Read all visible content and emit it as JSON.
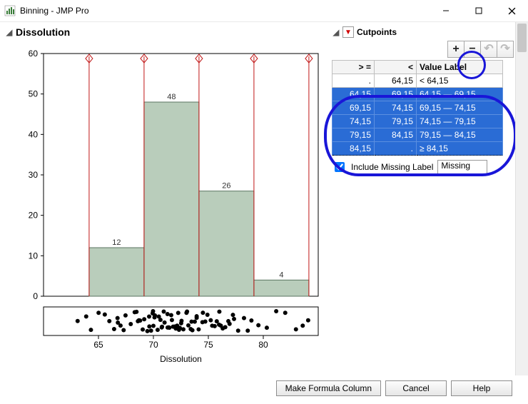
{
  "window": {
    "title": "Binning - JMP Pro"
  },
  "left_panel": {
    "header": "Dissolution"
  },
  "chart_data": {
    "type": "bar",
    "categories": [
      64.15,
      69.15,
      74.15,
      79.15,
      84.15
    ],
    "bar_centers": [
      66.65,
      71.65,
      76.65,
      81.65
    ],
    "values": [
      12,
      48,
      26,
      4
    ],
    "data_labels": [
      "12",
      "48",
      "26",
      "4"
    ],
    "xlabel": "Dissolution",
    "ylabel": "",
    "xticks": [
      65,
      70,
      75,
      80
    ],
    "yticks": [
      0,
      10,
      20,
      30,
      40,
      50,
      60
    ],
    "xlim": [
      60,
      85
    ],
    "ylim": [
      0,
      60
    ],
    "cutpoints": [
      64.15,
      69.15,
      74.15,
      79.15,
      84.15
    ],
    "rug_points": [
      63.2,
      63.8,
      64.4,
      65.0,
      65.6,
      66.0,
      66.4,
      66.8,
      66.8,
      67.0,
      67.2,
      67.4,
      68.0,
      68.2,
      68.4,
      68.6,
      68.6,
      68.8,
      69.0,
      69.2,
      69.4,
      69.6,
      69.6,
      69.8,
      70.0,
      70.0,
      70.0,
      70.2,
      70.2,
      70.4,
      70.4,
      70.6,
      70.8,
      70.8,
      71.0,
      71.0,
      71.2,
      71.2,
      71.4,
      71.4,
      71.6,
      71.6,
      71.8,
      72.0,
      72.0,
      72.2,
      72.2,
      72.4,
      72.4,
      72.6,
      72.6,
      72.8,
      73.0,
      73.0,
      73.2,
      73.4,
      73.4,
      73.6,
      73.8,
      74.0,
      74.0,
      74.2,
      74.4,
      74.6,
      74.8,
      75.0,
      75.2,
      75.4,
      75.6,
      75.8,
      76.0,
      76.0,
      76.2,
      76.4,
      76.6,
      76.8,
      77.0,
      77.2,
      77.4,
      77.8,
      78.2,
      78.6,
      79.0,
      79.6,
      80.4,
      81.2,
      82.0,
      83.0,
      83.6,
      84.0
    ]
  },
  "cutpoints_panel": {
    "header": "Cutpoints",
    "toolbar": {
      "add": "+",
      "remove": "−",
      "undo": "↶",
      "redo": "↷"
    },
    "columns": {
      "ge": "> =",
      "lt": "<",
      "label": "Value Label"
    },
    "rows": [
      {
        "ge": ".",
        "lt": "64,15",
        "label": "< 64,15",
        "selected": false
      },
      {
        "ge": "64,15",
        "lt": "69,15",
        "label": "64,15 — 69,15",
        "selected": true
      },
      {
        "ge": "69,15",
        "lt": "74,15",
        "label": "69,15 — 74,15",
        "selected": true
      },
      {
        "ge": "74,15",
        "lt": "79,15",
        "label": "74,15 — 79,15",
        "selected": true
      },
      {
        "ge": "79,15",
        "lt": "84,15",
        "label": "79,15 — 84,15",
        "selected": true
      },
      {
        "ge": "84,15",
        "lt": ".",
        "label": "≥ 84,15",
        "selected": true
      }
    ],
    "include_missing_label": "Include Missing Label",
    "missing_value": "Missing"
  },
  "footer": {
    "make_formula": "Make Formula Column",
    "cancel": "Cancel",
    "help": "Help"
  }
}
